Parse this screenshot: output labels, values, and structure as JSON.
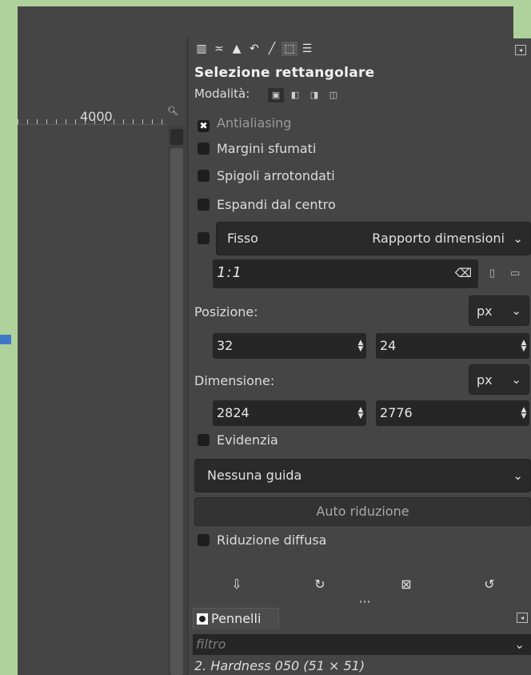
{
  "canvas": {
    "ruler_label": "4000",
    "zoom_icon": "zoom-icon"
  },
  "dock": {
    "tabs": [
      {
        "icon": "layers-icon",
        "glyph": "▥"
      },
      {
        "icon": "channels-icon",
        "glyph": "≍"
      },
      {
        "icon": "histogram-icon",
        "glyph": "▲"
      },
      {
        "icon": "undo-history-icon",
        "glyph": "↶"
      },
      {
        "icon": "paintbrush-icon",
        "glyph": "╱"
      },
      {
        "icon": "tool-options-icon",
        "glyph": "⬚"
      },
      {
        "icon": "device-status-icon",
        "glyph": "☰"
      }
    ],
    "panel_menu_glyph": "◂"
  },
  "tool_options": {
    "title": "Selezione rettangolare",
    "mode_label": "Modalità:",
    "options": {
      "antialiasing": {
        "label": "Antialiasing",
        "checked": true,
        "check_glyph": "✖"
      },
      "feather_edges": {
        "label": "Margini sfumati",
        "checked": false
      },
      "rounded_corners": {
        "label": "Spigoli arrotondati",
        "checked": false
      },
      "expand_from_center": {
        "label": "Espandi dal centro",
        "checked": false
      }
    },
    "fixed": {
      "label": "Fisso",
      "selected": "Rapporto dimensioni",
      "chevron": "⌄",
      "ratio_value": "1:1",
      "clear_glyph": "⌫"
    },
    "position": {
      "label": "Posizione:",
      "unit": "px",
      "x": "32",
      "y": "24"
    },
    "size": {
      "label": "Dimensione:",
      "unit": "px",
      "w": "2824",
      "h": "2776"
    },
    "highlight": {
      "label": "Evidenzia",
      "checked": false
    },
    "guides": {
      "selected": "Nessuna guida"
    },
    "auto_shrink_label": "Auto riduzione",
    "shrink_merged": {
      "label": "Riduzione diffusa",
      "checked": false
    }
  },
  "footer": {
    "save_glyph": "⇩",
    "restore_glyph": "↻",
    "delete_glyph": "⊠",
    "reset_glyph": "↺"
  },
  "brushes": {
    "tab_label": "Pennelli",
    "filter_placeholder": "filtro",
    "selected_brush": "2. Hardness 050 (51 × 51)"
  },
  "colors": {
    "desktop": "#afd19b",
    "panel": "#454545",
    "field": "#262626",
    "accent_handle": "#3d78c9"
  }
}
